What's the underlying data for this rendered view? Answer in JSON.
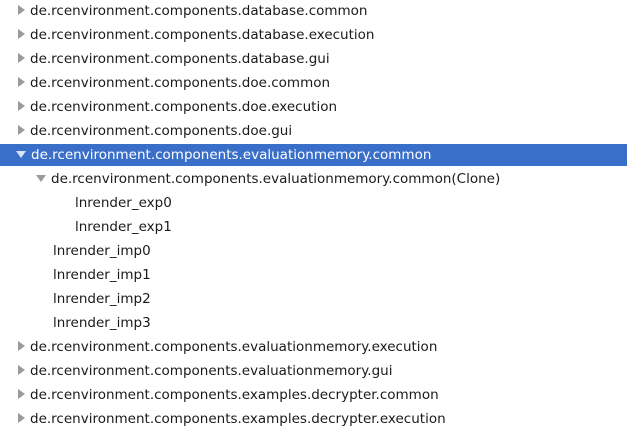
{
  "tree": {
    "rows": [
      {
        "label": "de.rcenvironment.components.database.common",
        "arrow": "right"
      },
      {
        "label": "de.rcenvironment.components.database.execution",
        "arrow": "right"
      },
      {
        "label": "de.rcenvironment.components.database.gui",
        "arrow": "right"
      },
      {
        "label": "de.rcenvironment.components.doe.common",
        "arrow": "right"
      },
      {
        "label": "de.rcenvironment.components.doe.execution",
        "arrow": "right"
      },
      {
        "label": "de.rcenvironment.components.doe.gui",
        "arrow": "right"
      },
      {
        "label": "de.rcenvironment.components.evaluationmemory.common",
        "arrow": "down",
        "selected": true
      },
      {
        "label": "de.rcenvironment.components.evaluationmemory.common(Clone)",
        "arrow": "down"
      },
      {
        "label": "lnrender_exp0",
        "arrow": "none"
      },
      {
        "label": "lnrender_exp1",
        "arrow": "none"
      },
      {
        "label": "lnrender_imp0",
        "arrow": "none"
      },
      {
        "label": "lnrender_imp1",
        "arrow": "none"
      },
      {
        "label": "lnrender_imp2",
        "arrow": "none"
      },
      {
        "label": "lnrender_imp3",
        "arrow": "none"
      },
      {
        "label": "de.rcenvironment.components.evaluationmemory.execution",
        "arrow": "right"
      },
      {
        "label": "de.rcenvironment.components.evaluationmemory.gui",
        "arrow": "right"
      },
      {
        "label": "de.rcenvironment.components.examples.decrypter.common",
        "arrow": "right"
      },
      {
        "label": "de.rcenvironment.components.examples.decrypter.execution",
        "arrow": "right"
      }
    ]
  },
  "colors": {
    "selection": "#3a6fc9",
    "arrow": "#9a9a9a",
    "text": "#1a1a1a"
  }
}
